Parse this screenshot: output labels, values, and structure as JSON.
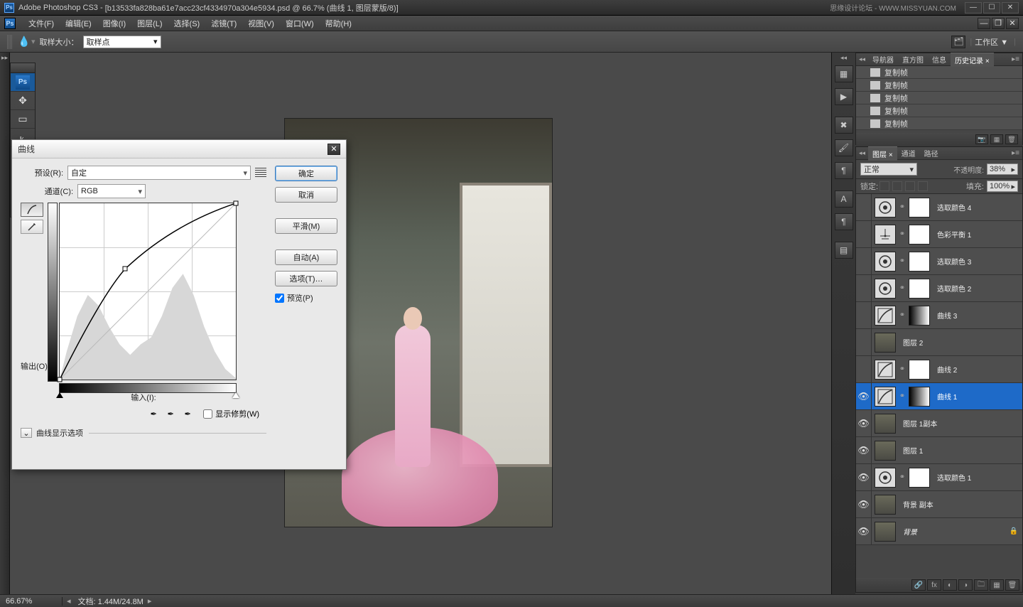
{
  "title": {
    "app": "Adobe Photoshop CS3",
    "doc": "[b13533fa828ba61e7acc23cf4334970a304e5934.psd @ 66.7% (曲线 1, 图层蒙版/8)]",
    "watermark": "思缘设计论坛 - WWW.MISSYUAN.COM"
  },
  "menu": [
    "文件(F)",
    "编辑(E)",
    "图像(I)",
    "图层(L)",
    "选择(S)",
    "滤镜(T)",
    "视图(V)",
    "窗口(W)",
    "帮助(H)"
  ],
  "options": {
    "sample_label": "取样大小：",
    "sample_value": "取样点",
    "workspace_label": "工作区 ▼"
  },
  "curves": {
    "title": "曲线",
    "preset_label": "预设(R):",
    "preset_value": "自定",
    "channel_label": "通道(C):",
    "channel_value": "RGB",
    "output_label": "输出(O):",
    "input_label": "输入(I):",
    "show_clip": "显示修剪(W)",
    "expand": "曲线显示选项",
    "buttons": {
      "ok": "确定",
      "cancel": "取消",
      "smooth": "平滑(M)",
      "auto": "自动(A)",
      "options": "选项(T)…"
    },
    "preview": "预览(P)"
  },
  "history": {
    "tabs": [
      "导航器",
      "直方图",
      "信息",
      "历史记录 ×"
    ],
    "items": [
      "复制帧",
      "复制帧",
      "复制帧",
      "复制帧",
      "复制帧"
    ]
  },
  "layers_panel": {
    "tabs": [
      "图层 ×",
      "通道",
      "路径"
    ],
    "blend_mode": "正常",
    "opacity_label": "不透明度:",
    "opacity_value": "38%",
    "lock_label": "锁定:",
    "fill_label": "填充:",
    "fill_value": "100%",
    "layers": [
      {
        "visible": false,
        "type": "adj",
        "mask": "white",
        "name": "选取颜色 4",
        "adj": "selcolor"
      },
      {
        "visible": false,
        "type": "adj",
        "mask": "white",
        "name": "色彩平衡 1",
        "adj": "colorbal"
      },
      {
        "visible": false,
        "type": "adj",
        "mask": "white",
        "name": "选取颜色 3",
        "adj": "selcolor"
      },
      {
        "visible": false,
        "type": "adj",
        "mask": "white",
        "name": "选取颜色 2",
        "adj": "selcolor"
      },
      {
        "visible": false,
        "type": "adj",
        "mask": "grad",
        "name": "曲线 3",
        "adj": "curves"
      },
      {
        "visible": false,
        "type": "img",
        "mask": "",
        "name": "图层 2"
      },
      {
        "visible": false,
        "type": "adj",
        "mask": "white",
        "name": "曲线 2",
        "adj": "curves"
      },
      {
        "visible": true,
        "type": "adj",
        "mask": "grad",
        "name": "曲线 1",
        "adj": "curves",
        "selected": true
      },
      {
        "visible": true,
        "type": "img",
        "mask": "",
        "name": "图层 1副本"
      },
      {
        "visible": true,
        "type": "img",
        "mask": "",
        "name": "图层 1"
      },
      {
        "visible": true,
        "type": "adj",
        "mask": "white",
        "name": "选取颜色 1",
        "adj": "selcolor"
      },
      {
        "visible": true,
        "type": "img",
        "mask": "",
        "name": "背景 副本"
      },
      {
        "visible": true,
        "type": "img",
        "mask": "",
        "name": "背景",
        "bg": true,
        "locked": true
      }
    ]
  },
  "status": {
    "zoom": "66.67%",
    "doc": "文档: 1.44M/24.8M"
  },
  "chart_data": {
    "type": "line",
    "title": "曲线",
    "xlabel": "输入",
    "ylabel": "输出",
    "xlim": [
      0,
      255
    ],
    "ylim": [
      0,
      255
    ],
    "series": [
      {
        "name": "RGB 曲线",
        "x": [
          0,
          95,
          255
        ],
        "y": [
          0,
          160,
          255
        ]
      }
    ],
    "histogram_note": "背景灰色直方图为当前通道像素分布（估读）"
  }
}
